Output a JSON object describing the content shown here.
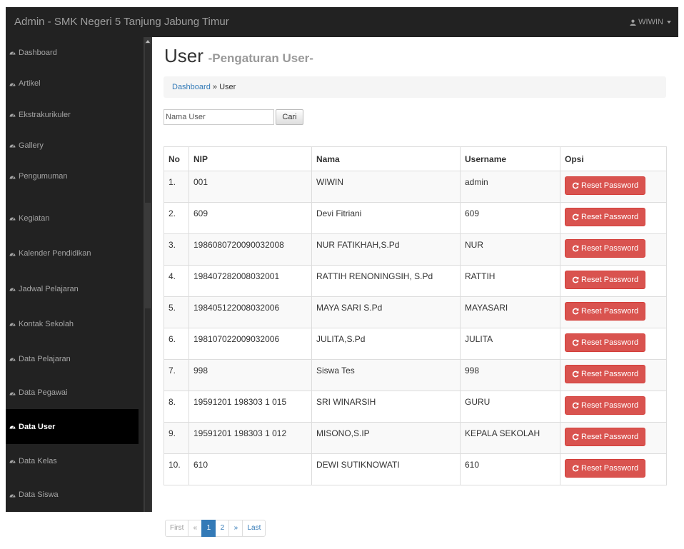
{
  "navbar": {
    "brand": "Admin - SMK Negeri 5 Tanjung Jabung Timur",
    "user_label": "WIWIN",
    "user_icon": "user-icon"
  },
  "sidebar": {
    "items": [
      {
        "label": "Dashboard",
        "icon": "dashboard-icon"
      },
      {
        "label": "Artikel",
        "icon": "dashboard-icon"
      },
      {
        "label": "Ekstrakurikuler",
        "icon": "dashboard-icon"
      },
      {
        "label": "Gallery",
        "icon": "dashboard-icon"
      },
      {
        "label": "Pengumuman",
        "icon": "dashboard-icon"
      },
      {
        "label": "Kegiatan",
        "icon": "dashboard-icon"
      },
      {
        "label": "Kalender Pendidikan",
        "icon": "dashboard-icon"
      },
      {
        "label": "Jadwal Pelajaran",
        "icon": "dashboard-icon"
      },
      {
        "label": "Kontak Sekolah",
        "icon": "dashboard-icon"
      },
      {
        "label": "Data Pelajaran",
        "icon": "dashboard-icon"
      },
      {
        "label": "Data Pegawai",
        "icon": "dashboard-icon"
      },
      {
        "label": "Data User",
        "icon": "dashboard-icon",
        "active": true
      },
      {
        "label": "Data Kelas",
        "icon": "dashboard-icon"
      },
      {
        "label": "Data Siswa",
        "icon": "dashboard-icon"
      }
    ]
  },
  "header": {
    "title": "User",
    "subtitle": "-Pengaturan User-"
  },
  "breadcrumb": {
    "home": "Dashboard",
    "separator": "»",
    "current": "User"
  },
  "search": {
    "placeholder": "Nama User",
    "button_label": "Cari"
  },
  "table": {
    "columns": [
      "No",
      "NIP",
      "Nama",
      "Username",
      "Opsi"
    ],
    "action_label": "Reset Password",
    "rows": [
      {
        "no": "1.",
        "nip": "001",
        "nama": "WIWIN",
        "username": "admin"
      },
      {
        "no": "2.",
        "nip": "609",
        "nama": "Devi Fitriani",
        "username": "609"
      },
      {
        "no": "3.",
        "nip": "198608072009003​2008",
        "nama": "NUR FATIKHAH,S.Pd",
        "username": "NUR"
      },
      {
        "no": "4.",
        "nip": "198407282008032001",
        "nama": "RATTIH RENONINGSIH, S.Pd",
        "username": "RATTIH"
      },
      {
        "no": "5.",
        "nip": "198405122008032006",
        "nama": "MAYA SARI S.Pd",
        "username": "MAYASARI"
      },
      {
        "no": "6.",
        "nip": "198107022009032006",
        "nama": "JULITA,S.Pd",
        "username": "JULITA"
      },
      {
        "no": "7.",
        "nip": "998",
        "nama": "Siswa Tes",
        "username": "998"
      },
      {
        "no": "8.",
        "nip": "19591201 198303 1 015",
        "nama": "SRI WINARSIH",
        "username": "GURU"
      },
      {
        "no": "9.",
        "nip": "19591201 198303 1 012",
        "nama": "MISONO,S.IP",
        "username": "KEPALA SEKOLAH"
      },
      {
        "no": "10.",
        "nip": "610",
        "nama": "DEWI SUTIKNOWATI",
        "username": "610"
      }
    ]
  },
  "pagination": {
    "first": "First",
    "prev": "«",
    "pages": [
      "1",
      "2"
    ],
    "current": "1",
    "next": "»",
    "last": "Last"
  },
  "colors": {
    "navbar_bg": "#222222",
    "danger": "#d9534f",
    "link": "#337ab7"
  }
}
